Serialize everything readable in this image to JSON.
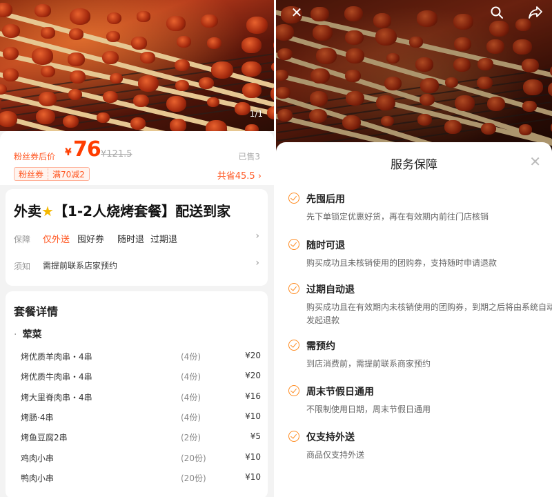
{
  "left": {
    "page_counter": "1/1",
    "price_label": "粉丝券后价",
    "currency": "¥",
    "price": "76",
    "original_price": "¥121.5",
    "sold": "已售3",
    "coupon_tag": "粉丝券",
    "coupon_rule": "满70减2",
    "total_save": "共省45.5 ›",
    "deal_title_prefix": "外卖",
    "deal_title_suffix": "【1-2人烧烤套餐】配送到家",
    "guarantee_label": "保障",
    "guarantees": [
      "仅外送",
      "囤好券",
      "随时退",
      "过期退"
    ],
    "notice_label": "须知",
    "notice_text": "需提前联系店家预约",
    "package_title": "套餐详情",
    "package_group": "荤菜",
    "items": [
      {
        "name": "烤优质羊肉串・4串",
        "qty": "(4份)",
        "price": "¥20"
      },
      {
        "name": "烤优质牛肉串・4串",
        "qty": "(4份)",
        "price": "¥20"
      },
      {
        "name": "烤大里脊肉串・4串",
        "qty": "(4份)",
        "price": "¥16"
      },
      {
        "name": "烤肠·4串",
        "qty": "(4份)",
        "price": "¥10"
      },
      {
        "name": "烤鱼豆腐2串",
        "qty": "(2份)",
        "price": "¥5"
      },
      {
        "name": "鸡肉小串",
        "qty": "(20份)",
        "price": "¥10"
      },
      {
        "name": "鸭肉小串",
        "qty": "(20份)",
        "price": "¥10"
      }
    ]
  },
  "right": {
    "sheet_title": "服务保障",
    "close_symbol": "✕",
    "services": [
      {
        "title": "先囤后用",
        "desc": "先下单锁定优惠好货，再在有效期内前往门店核销"
      },
      {
        "title": "随时可退",
        "desc": "购买成功且未核销使用的团购券，支持随时申请退款"
      },
      {
        "title": "过期自动退",
        "desc": "购买成功且在有效期内未核销使用的团购券，到期之后将由系统自动发起退款"
      },
      {
        "title": "需预约",
        "desc": "到店消费前，需提前联系商家预约"
      },
      {
        "title": "周末节假日通用",
        "desc": "不限制使用日期，周末节假日通用"
      },
      {
        "title": "仅支持外送",
        "desc": "商品仅支持外送"
      }
    ]
  },
  "icons": {
    "close": "close-icon",
    "search": "search-icon",
    "share": "share-icon",
    "check": "check-circle-icon",
    "chevron": "chevron-right-icon"
  },
  "colors": {
    "accent": "#ff5722",
    "price": "#ff3d00",
    "check": "#ff8a1f",
    "page_bg": "#f3f3f3"
  }
}
